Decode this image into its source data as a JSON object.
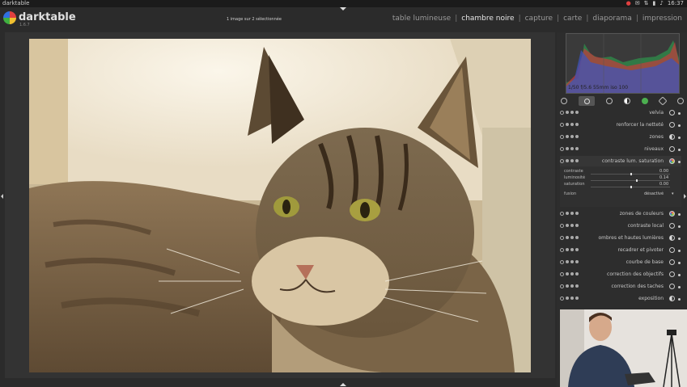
{
  "os_bar": {
    "title": "darktable",
    "clock": "16:37"
  },
  "header": {
    "app_name": "darktable",
    "version": "1.6.7",
    "selection_info": "1 image sur 2 sélectionnée",
    "views": [
      {
        "label": "table lumineuse",
        "active": false
      },
      {
        "label": "chambre noire",
        "active": true
      },
      {
        "label": "capture",
        "active": false
      },
      {
        "label": "carte",
        "active": false
      },
      {
        "label": "diaporama",
        "active": false
      },
      {
        "label": "impression",
        "active": false
      }
    ],
    "separator": "|"
  },
  "histogram": {
    "info": "1/50 f/5.6 55mm iso 100"
  },
  "module_groups": [
    "favorites",
    "basic",
    "tone",
    "color",
    "correction",
    "effect",
    "presets"
  ],
  "modules": [
    {
      "label": "velvia",
      "icon": "circle-icon"
    },
    {
      "label": "renforcer la netteté",
      "icon": "circle-icon"
    },
    {
      "label": "zones",
      "icon": "half-circle-icon"
    },
    {
      "label": "niveaux",
      "icon": "circle-icon"
    },
    {
      "label": "contraste lum. saturation",
      "icon": "color-circle-icon",
      "expanded": true
    },
    {
      "label": "zones de couleurs",
      "icon": "color-circle-icon"
    },
    {
      "label": "contraste local",
      "icon": "circle-icon"
    },
    {
      "label": "ombres et hautes lumières",
      "icon": "half-circle-icon"
    },
    {
      "label": "recadrer et pivoter",
      "icon": "circle-icon"
    },
    {
      "label": "courbe de base",
      "icon": "circle-icon"
    },
    {
      "label": "correction des objectifs",
      "icon": "circle-icon"
    },
    {
      "label": "correction des taches",
      "icon": "circle-icon"
    },
    {
      "label": "exposition",
      "icon": "half-circle-icon"
    }
  ],
  "expanded_params": [
    {
      "label": "contraste",
      "value": "0.00",
      "frac": 0.5
    },
    {
      "label": "luminosité",
      "value": "0.14",
      "frac": 0.57
    },
    {
      "label": "saturation",
      "value": "0.00",
      "frac": 0.5
    }
  ],
  "fusion": {
    "label": "fusion",
    "value": "désactivé"
  },
  "colors": {
    "accent": "#e6e6e6",
    "panel": "#2d2d2d",
    "bg": "#2b2b2b"
  }
}
